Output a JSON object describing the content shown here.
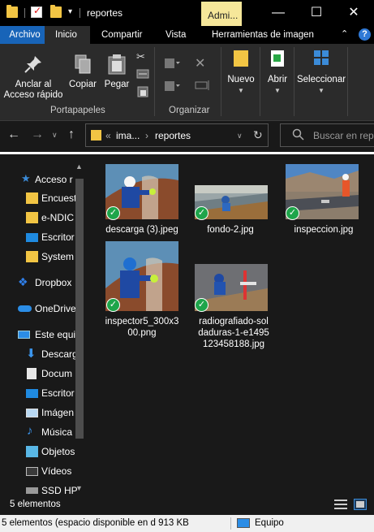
{
  "window": {
    "title": "reportes",
    "contextual_tab": "Admi...",
    "minimize": "—",
    "maximize": "☐",
    "close": "✕"
  },
  "ribbon_tabs": [
    "Archivo",
    "Inicio",
    "Compartir",
    "Vista",
    "Herramientas de imagen"
  ],
  "ribbon": {
    "pin_label_1": "Anclar al",
    "pin_label_2": "Acceso rápido",
    "copy_label": "Copiar",
    "paste_label": "Pegar",
    "group_clipboard": "Portapapeles",
    "group_organize": "Organizar",
    "new_label": "Nuevo",
    "open_label": "Abrir",
    "select_label": "Seleccionar"
  },
  "address": {
    "crumb_prefix": "«",
    "crumb_1": "ima...",
    "crumb_sep": "›",
    "crumb_2": "reportes",
    "search_placeholder": "Buscar en repo"
  },
  "nav": [
    {
      "label": "Acceso r",
      "icon": "star-icon"
    },
    {
      "label": "Encuest",
      "icon": "folder-icon"
    },
    {
      "label": "e-NDIC",
      "icon": "folder-icon"
    },
    {
      "label": "Escritor",
      "icon": "desktop-icon"
    },
    {
      "label": "System",
      "icon": "folder-icon"
    },
    {
      "label": "Dropbox",
      "icon": "dropbox-icon"
    },
    {
      "label": "OneDrive",
      "icon": "onedrive-icon"
    },
    {
      "label": "Este equi",
      "icon": "pc-icon"
    },
    {
      "label": "Descarg",
      "icon": "download-icon"
    },
    {
      "label": "Docum",
      "icon": "document-icon"
    },
    {
      "label": "Escritor",
      "icon": "desktop-icon"
    },
    {
      "label": "Imágen",
      "icon": "pictures-icon"
    },
    {
      "label": "Música",
      "icon": "music-icon"
    },
    {
      "label": "Objetos",
      "icon": "3d-objects-icon"
    },
    {
      "label": "Vídeos",
      "icon": "videos-icon"
    },
    {
      "label": "SSD HP",
      "icon": "drive-icon"
    }
  ],
  "files": [
    {
      "name_1": "descarga (3).jpeg",
      "name_2": "",
      "name_3": ""
    },
    {
      "name_1": "fondo-2.jpg",
      "name_2": "",
      "name_3": ""
    },
    {
      "name_1": "inspeccion.jpg",
      "name_2": "",
      "name_3": ""
    },
    {
      "name_1": "inspector5_300x3",
      "name_2": "00.png",
      "name_3": ""
    },
    {
      "name_1": "radiografiado-sol",
      "name_2": "daduras-1-e1495",
      "name_3": "123458188.jpg"
    }
  ],
  "status": {
    "count": "5 elementos",
    "bottom_left": "5 elementos (espacio disponible en d 913 KB",
    "bottom_right": "Equipo"
  },
  "colors": {
    "accent": "#1864b8",
    "folder": "#f2c544",
    "sync_ok": "#1ea54a",
    "admin_tab": "#f6e79a"
  }
}
